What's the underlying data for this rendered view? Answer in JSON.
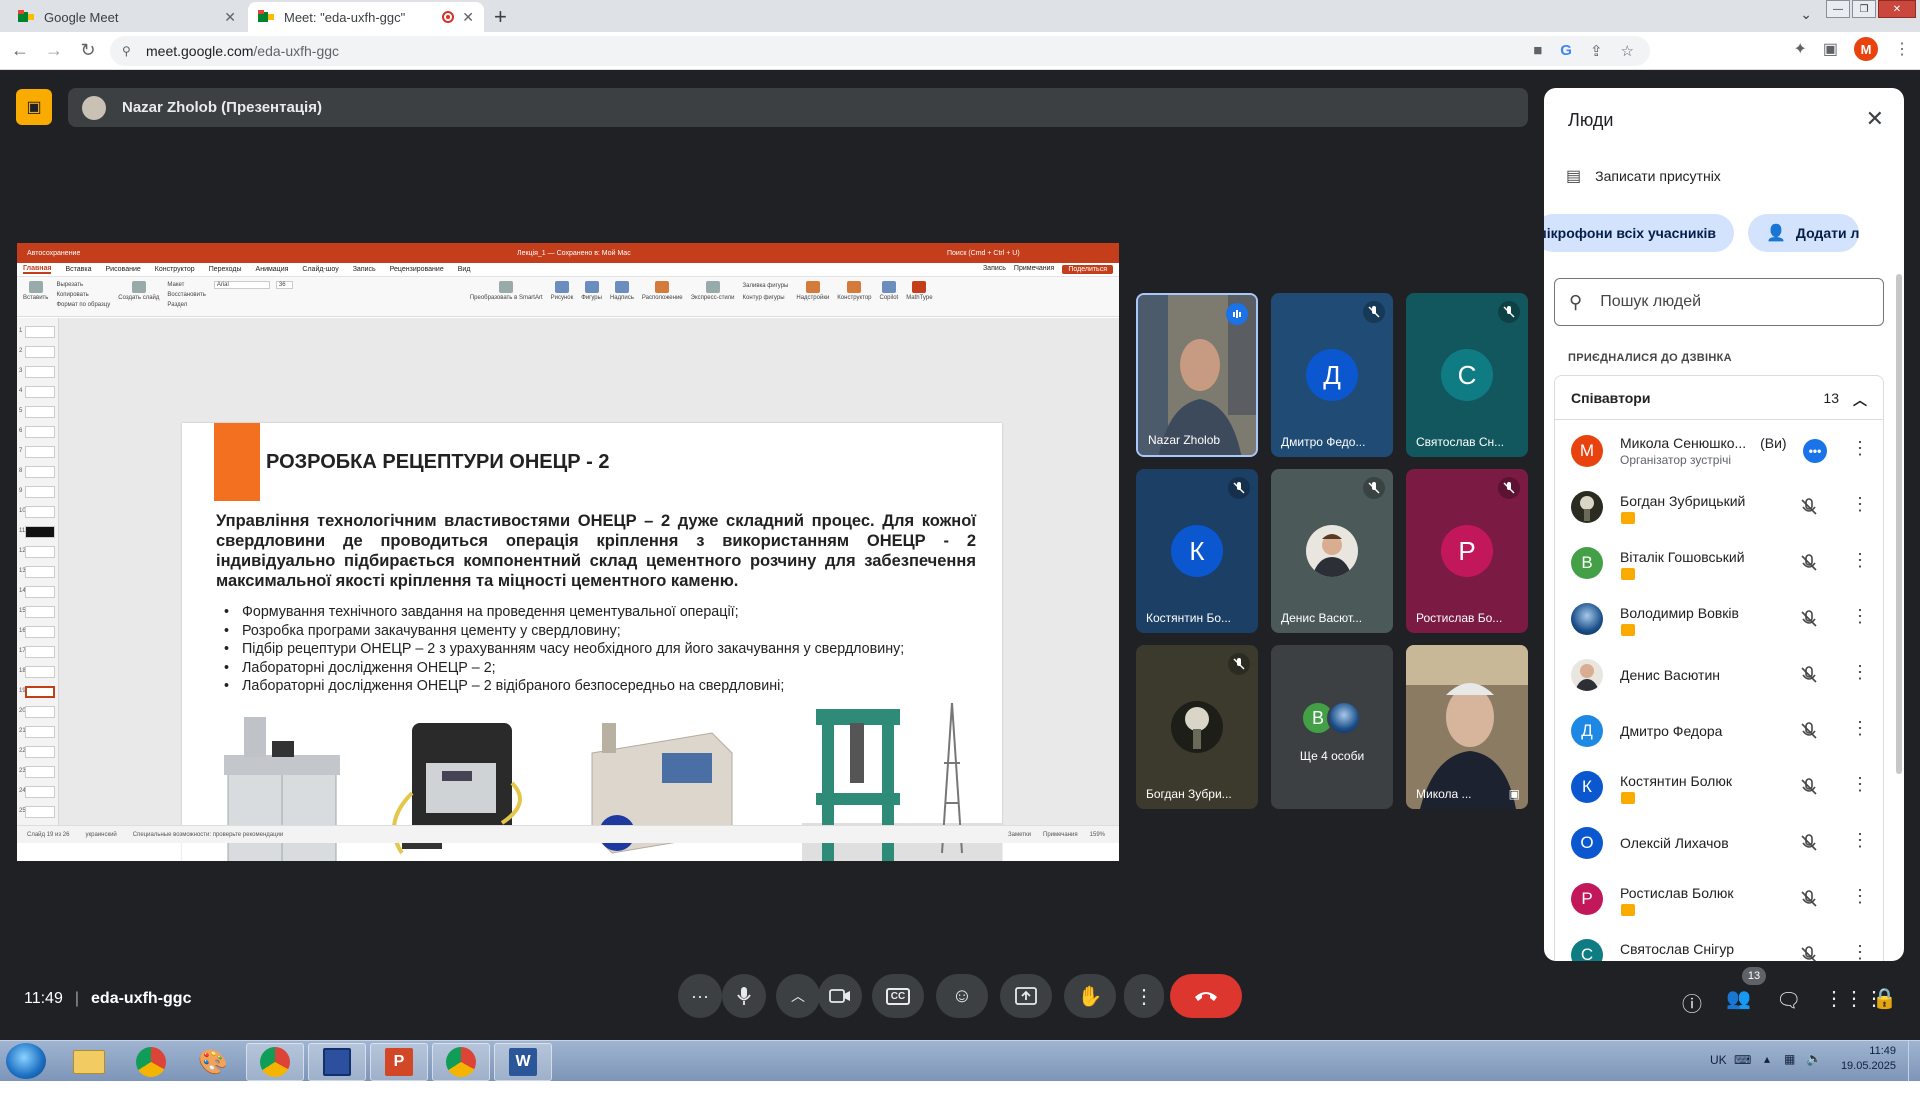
{
  "browser": {
    "tabs": [
      {
        "title": "Google Meet"
      },
      {
        "title": "Meet: \"eda-uxfh-ggc\""
      }
    ],
    "url_host": "meet.google.com",
    "url_path": "/eda-uxfh-ggc",
    "profile_letter": "M"
  },
  "presentation_banner": {
    "presenter": "Nazar Zholob (Презентація)"
  },
  "powerpoint": {
    "title_left": "Автосохранение",
    "doc_name": "Лекція_1 — Сохранено в: Мой Mac",
    "search": "Поиск (Cmd + Ctrl + U)",
    "menu": [
      "Главная",
      "Вставка",
      "Рисование",
      "Конструктор",
      "Переходы",
      "Анимация",
      "Слайд-шоу",
      "Запись",
      "Рецензирование",
      "Вид"
    ],
    "menu_record": "Запись",
    "menu_comments": "Примечания",
    "menu_share": "Поделиться",
    "ribbon": [
      "Вставить",
      "Вырезать",
      "Копировать",
      "Формат по образцу",
      "Создать слайд",
      "Макет",
      "Восстановить",
      "Раздел",
      "Arial",
      "36",
      "Преобразовать в SmartArt",
      "Рисунок",
      "Фигуры",
      "Надпись",
      "Расположение",
      "Экспресс-стили",
      "Заливка фигуры",
      "Контур фигуры",
      "Надстройки",
      "Конструктор",
      "Copilot",
      "MathType"
    ],
    "status_left": "Слайд 19 из 26",
    "status_lang": "украинский",
    "status_access": "Специальные возможности: проверьте рекомендации",
    "status_notes": "Заметки",
    "status_comments": "Примечания",
    "zoom": "159%",
    "thumb_numbers": [
      "1",
      "2",
      "3",
      "4",
      "5",
      "6",
      "7",
      "8",
      "9",
      "10",
      "11",
      "12",
      "13",
      "14",
      "15",
      "16",
      "17",
      "18",
      "19",
      "20",
      "21",
      "22",
      "23",
      "24",
      "25",
      "26"
    ]
  },
  "slide": {
    "title": "РОЗРОБКА РЕЦЕПТУРИ ОНЕЦР - 2",
    "paragraph": "Управління технологічним властивостями ОНЕЦР – 2 дуже складний процес. Для кожної свердловини де проводиться операція кріплення з використанням ОНЕЦР - 2 індивідуально підбирається компонентний склад цементного розчину для забезпечення максимальної якості кріплення та міцності цементного каменю.",
    "bullets": [
      "Формування технічного завдання на проведення цементувальної операції;",
      "Розробка програми закачування цементу у свердловину;",
      "Підбір рецептури ОНЕЦР – 2 з урахуванням часу необхідного для його закачування у свердловину;",
      "Лабораторні дослідження ОНЕЦР – 2;",
      "Лабораторні дослідження ОНЕЦР – 2 відібраного безпосередньо на свердловині;"
    ]
  },
  "tiles": [
    {
      "name": "Nazar Zholob",
      "kind": "video"
    },
    {
      "name": "Дмитро Федо...",
      "letter": "Д",
      "color": "#0b57d0",
      "bg": "#1f4b74"
    },
    {
      "name": "Святослав Сн...",
      "letter": "С",
      "color": "#0f7c84",
      "bg": "#12575e"
    },
    {
      "name": "Костянтин Бо...",
      "letter": "К",
      "color": "#0b57d0",
      "bg": "#1c3f66"
    },
    {
      "name": "Денис Васют...",
      "kind": "avatar",
      "bg": "#4b5a58"
    },
    {
      "name": "Ростислав Бо...",
      "letter": "Р",
      "color": "#c2185b",
      "bg": "#7b1a43"
    },
    {
      "name": "Богдан Зубри...",
      "kind": "avatar",
      "bg": "#3b3a2c"
    },
    {
      "name": "Ще 4 особи",
      "kind": "more",
      "letter": "В"
    },
    {
      "name": "Микола ...",
      "kind": "video2"
    }
  ],
  "people_panel": {
    "title": "Люди",
    "record_attendance": "Записати присутніх",
    "mute_all": "кнути мікрофони всіх учасників",
    "add_people": "Додати л",
    "search_placeholder": "Пошук людей",
    "joined_label": "ПРИЄДНАЛИСЯ ДО ДЗВІНКА",
    "collaborators_label": "Співавтори",
    "collaborators_count": "13",
    "people": [
      {
        "name": "Микола Сенюшко...",
        "you": "(Ви)",
        "sub": "Організатор зустрічі",
        "letter": "М",
        "color": "#e8430e"
      },
      {
        "name": "Богдан Зубрицький",
        "letter": "",
        "color": "#4a4a3a",
        "badge": true
      },
      {
        "name": "Віталік Гошовський",
        "letter": "В",
        "color": "#43a047",
        "badge": true
      },
      {
        "name": "Володимир Вовків",
        "letter": "",
        "color": "#1b4f8a",
        "badge": true
      },
      {
        "name": "Денис Васютин",
        "letter": "",
        "color": "#b0b7b2"
      },
      {
        "name": "Дмитро Федора",
        "letter": "Д",
        "color": "#1e88e5"
      },
      {
        "name": "Костянтин Болюк",
        "letter": "К",
        "color": "#0b57d0",
        "badge": true
      },
      {
        "name": "Олексій Лихачов",
        "letter": "О",
        "color": "#0b57d0"
      },
      {
        "name": "Ростислав Болюк",
        "letter": "Р",
        "color": "#c2185b",
        "badge": true
      },
      {
        "name": "Святослав Снігур",
        "letter": "С",
        "color": "#0f7c84"
      }
    ]
  },
  "meeting": {
    "time": "11:49",
    "code": "eda-uxfh-ggc",
    "people_count": "13"
  },
  "taskbar": {
    "lang": "UK",
    "time": "11:49",
    "date": "19.05.2025"
  }
}
